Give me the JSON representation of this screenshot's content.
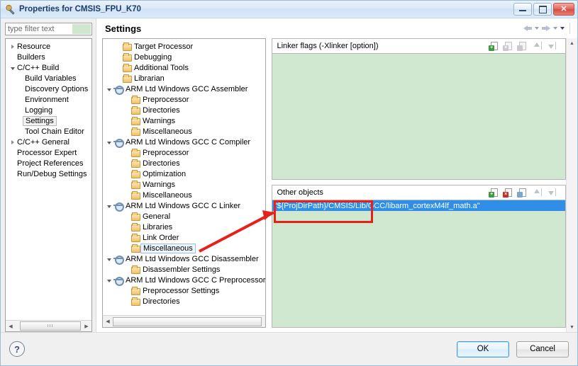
{
  "window": {
    "title": "Properties for CMSIS_FPU_K70",
    "icon": "properties-icon",
    "controls": {
      "minimize": "minimize-icon",
      "maximize": "maximize-icon",
      "close": "close-icon"
    }
  },
  "filter": {
    "placeholder": "type filter text",
    "value": ""
  },
  "left_tree": {
    "items": [
      {
        "label": "Resource",
        "indent": 1,
        "twisty": "collapsed",
        "selected": false
      },
      {
        "label": "Builders",
        "indent": 1,
        "twisty": "none",
        "selected": false
      },
      {
        "label": "C/C++ Build",
        "indent": 1,
        "twisty": "expanded",
        "selected": false
      },
      {
        "label": "Build Variables",
        "indent": 2,
        "twisty": "none",
        "selected": false
      },
      {
        "label": "Discovery Options",
        "indent": 2,
        "twisty": "none",
        "selected": false
      },
      {
        "label": "Environment",
        "indent": 2,
        "twisty": "none",
        "selected": false
      },
      {
        "label": "Logging",
        "indent": 2,
        "twisty": "none",
        "selected": false
      },
      {
        "label": "Settings",
        "indent": 2,
        "twisty": "none",
        "selected": true
      },
      {
        "label": "Tool Chain Editor",
        "indent": 2,
        "twisty": "none",
        "selected": false
      },
      {
        "label": "C/C++ General",
        "indent": 1,
        "twisty": "collapsed",
        "selected": false
      },
      {
        "label": "Processor Expert",
        "indent": 1,
        "twisty": "none",
        "selected": false
      },
      {
        "label": "Project References",
        "indent": 1,
        "twisty": "none",
        "selected": false
      },
      {
        "label": "Run/Debug Settings",
        "indent": 1,
        "twisty": "none",
        "selected": false
      }
    ]
  },
  "settings": {
    "title": "Settings",
    "nav": {
      "back": "back-arrow-icon",
      "back_menu": "chevron-down-icon",
      "forward": "forward-arrow-icon",
      "forward_menu": "chevron-down-icon",
      "view_menu": "view-menu-icon"
    }
  },
  "tool_tree": {
    "items": [
      {
        "label": "Target Processor",
        "indent": 1,
        "twisty": "none",
        "icon": "folder",
        "selected": false
      },
      {
        "label": "Debugging",
        "indent": 1,
        "twisty": "none",
        "icon": "folder",
        "selected": false
      },
      {
        "label": "Additional Tools",
        "indent": 1,
        "twisty": "none",
        "icon": "folder",
        "selected": false
      },
      {
        "label": "Librarian",
        "indent": 1,
        "twisty": "none",
        "icon": "folder",
        "selected": false
      },
      {
        "label": "ARM Ltd Windows GCC Assembler",
        "indent": 0,
        "twisty": "expanded",
        "icon": "gear",
        "selected": false
      },
      {
        "label": "Preprocessor",
        "indent": 2,
        "twisty": "none",
        "icon": "folder",
        "selected": false
      },
      {
        "label": "Directories",
        "indent": 2,
        "twisty": "none",
        "icon": "folder",
        "selected": false
      },
      {
        "label": "Warnings",
        "indent": 2,
        "twisty": "none",
        "icon": "folder",
        "selected": false
      },
      {
        "label": "Miscellaneous",
        "indent": 2,
        "twisty": "none",
        "icon": "folder",
        "selected": false
      },
      {
        "label": "ARM Ltd Windows GCC C Compiler",
        "indent": 0,
        "twisty": "expanded",
        "icon": "gear",
        "selected": false
      },
      {
        "label": "Preprocessor",
        "indent": 2,
        "twisty": "none",
        "icon": "folder",
        "selected": false
      },
      {
        "label": "Directories",
        "indent": 2,
        "twisty": "none",
        "icon": "folder",
        "selected": false
      },
      {
        "label": "Optimization",
        "indent": 2,
        "twisty": "none",
        "icon": "folder",
        "selected": false
      },
      {
        "label": "Warnings",
        "indent": 2,
        "twisty": "none",
        "icon": "folder",
        "selected": false
      },
      {
        "label": "Miscellaneous",
        "indent": 2,
        "twisty": "none",
        "icon": "folder",
        "selected": false
      },
      {
        "label": "ARM Ltd Windows GCC C Linker",
        "indent": 0,
        "twisty": "expanded",
        "icon": "gear",
        "selected": false
      },
      {
        "label": "General",
        "indent": 2,
        "twisty": "none",
        "icon": "folder",
        "selected": false
      },
      {
        "label": "Libraries",
        "indent": 2,
        "twisty": "none",
        "icon": "folder",
        "selected": false
      },
      {
        "label": "Link Order",
        "indent": 2,
        "twisty": "none",
        "icon": "folder",
        "selected": false
      },
      {
        "label": "Miscellaneous",
        "indent": 2,
        "twisty": "none",
        "icon": "folder",
        "selected": true
      },
      {
        "label": "ARM Ltd Windows GCC Disassembler",
        "indent": 0,
        "twisty": "expanded",
        "icon": "gear",
        "selected": false
      },
      {
        "label": "Disassembler Settings",
        "indent": 2,
        "twisty": "none",
        "icon": "folder",
        "selected": false
      },
      {
        "label": "ARM Ltd Windows GCC C Preprocessor",
        "indent": 0,
        "twisty": "expanded",
        "icon": "gear",
        "selected": false
      },
      {
        "label": "Preprocessor Settings",
        "indent": 2,
        "twisty": "none",
        "icon": "folder",
        "selected": false
      },
      {
        "label": "Directories",
        "indent": 2,
        "twisty": "none",
        "icon": "folder",
        "selected": false
      }
    ]
  },
  "groups": {
    "linker_flags": {
      "title": "Linker flags (-Xlinker [option])",
      "rows": [],
      "tools": [
        {
          "name": "add-icon",
          "kind": "add",
          "enabled": true
        },
        {
          "name": "delete-icon",
          "kind": "del",
          "enabled": false
        },
        {
          "name": "edit-icon",
          "kind": "edit",
          "enabled": false
        },
        {
          "name": "move-up-icon",
          "kind": "up",
          "enabled": false
        },
        {
          "name": "move-down-icon",
          "kind": "down",
          "enabled": false
        }
      ]
    },
    "other_objects": {
      "title": "Other objects",
      "rows": [
        {
          "value": "\"${ProjDirPath}/CMSIS/Lib/GCC/libarm_cortexM4lf_math.a\"",
          "selected": true
        }
      ],
      "tools": [
        {
          "name": "add-icon",
          "kind": "add",
          "enabled": true
        },
        {
          "name": "delete-icon",
          "kind": "del",
          "enabled": true
        },
        {
          "name": "edit-icon",
          "kind": "edit",
          "enabled": true
        },
        {
          "name": "move-up-icon",
          "kind": "up",
          "enabled": false
        },
        {
          "name": "move-down-icon",
          "kind": "down",
          "enabled": false
        }
      ]
    }
  },
  "footer": {
    "help": "?",
    "ok_label": "OK",
    "cancel_label": "Cancel"
  },
  "colors": {
    "list_background": "#cfe8cf",
    "selection": "#2f8fe8",
    "annotation": "#e8201a",
    "title_text": "#1c3d68"
  }
}
